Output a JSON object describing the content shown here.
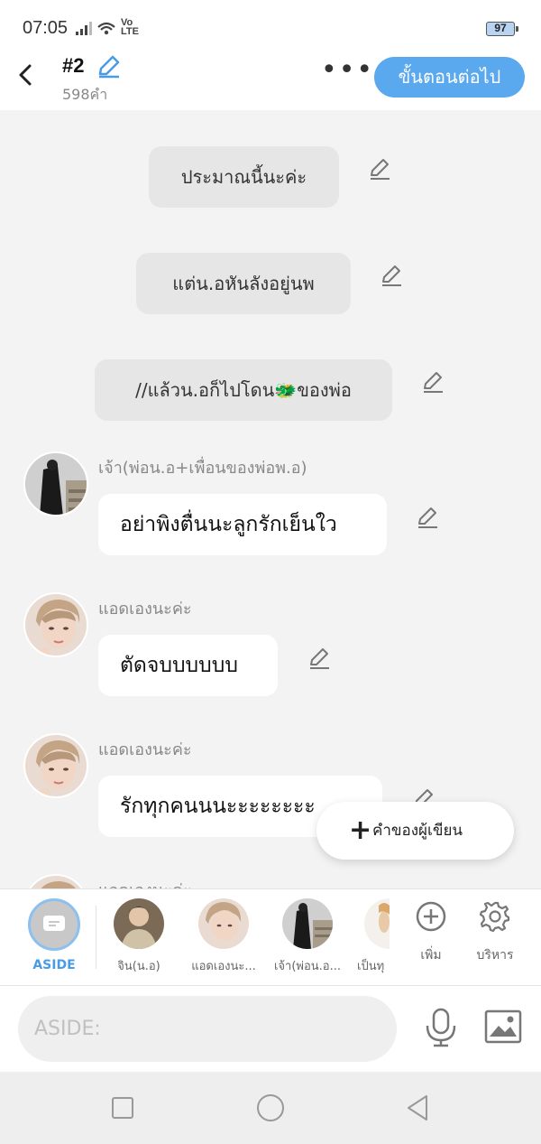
{
  "status": {
    "time": "07:05",
    "volte": "Vo LTE",
    "battery": "97"
  },
  "header": {
    "title": "#2",
    "word_count": "598คำ",
    "next_label": "ขั้นตอนต่อไป"
  },
  "narration": [
    {
      "text": "ประมาณนี้นะค่ะ"
    },
    {
      "text": "แต่น.อหันลังอยู่นพ"
    },
    {
      "text": "//แล้วน.อก็ไปโดน🐲ของพ่อ"
    }
  ],
  "messages": [
    {
      "speaker": "เจ้า(พ่อน.อ+เพื่อนของพ่อพ.อ)",
      "text": "อย่าพิงตื่นนะลูกรักเย็นใว"
    },
    {
      "speaker": "แอดเองนะค่ะ",
      "text": "ตัดจบบบบบบ"
    },
    {
      "speaker": "แอดเองนะค่ะ",
      "text": "รักทุกคนนนะะะะะะะะ"
    },
    {
      "speaker": "แอดเองนะค่ะ"
    }
  ],
  "fab": {
    "label": "คำของผู้เขียน"
  },
  "characters": [
    {
      "label": "ASIDE"
    },
    {
      "label": "จิน(น.อ)"
    },
    {
      "label": "แอดเองนะ..."
    },
    {
      "label": "เจ้า(พ่อน.อ..."
    },
    {
      "label": "เป็นทุ"
    }
  ],
  "tools": {
    "add_label": "เพิ่ม",
    "manage_label": "บริหาร"
  },
  "input": {
    "placeholder": "ASIDE:"
  },
  "colors": {
    "accent": "#5aa8ee",
    "aside_label": "#4a9be5"
  }
}
